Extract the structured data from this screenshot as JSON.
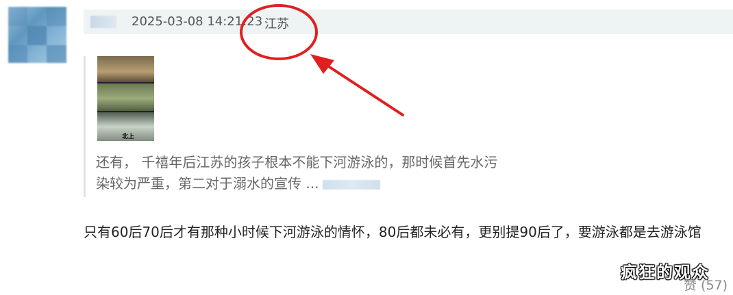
{
  "comment": {
    "meta": {
      "time": "2025-03-08 14:21:23",
      "location": "江苏"
    },
    "quote": {
      "image_caption": "北上",
      "text_line1": "还有， 千禧年后江苏的孩子根本不能下河游泳的，那时候首先水污",
      "text_line2": "染较为严重，第二对于溺水的宣传 ..."
    },
    "reply_text": "只有60后70后才有那种小时候下河游泳的情怀，80后都未必有，更别提90后了，要游泳都是去游泳馆",
    "like_label": "赞 (57)"
  },
  "watermark": "疯狂的观众",
  "colors": {
    "annotation": "#e02020",
    "meta_bar": "#eef3f3"
  }
}
